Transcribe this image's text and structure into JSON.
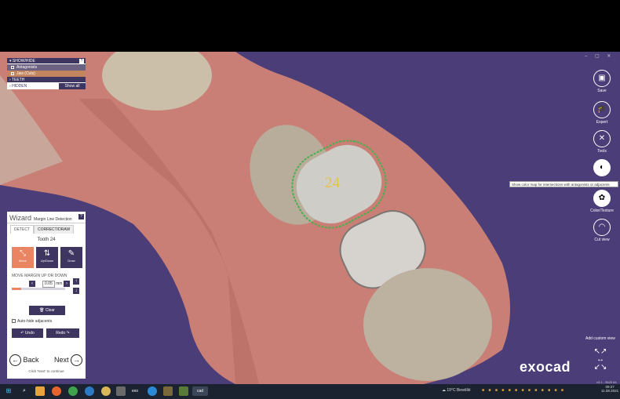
{
  "show_hide": {
    "section_label": "SHOW/HIDE",
    "help": "?",
    "items": [
      {
        "label": "Antagonists",
        "checked": false
      },
      {
        "label": "Jaw (Cuts)",
        "checked": false
      }
    ],
    "teeth_label": "TEETH",
    "hidden_label": "HIDDEN",
    "show_all_label": "Show all"
  },
  "wizard": {
    "title": "Wizard",
    "subtitle": "Margin Line Detection",
    "help": "?",
    "tabs": [
      {
        "label": "DETECT",
        "active": false
      },
      {
        "label": "CORRECT/DRAW",
        "active": true
      }
    ],
    "tooth_label": "Tooth 24",
    "modes": [
      {
        "label": "Move",
        "icon": "move-icon",
        "active": true
      },
      {
        "label": "Up/Down",
        "icon": "updown-icon",
        "active": false
      },
      {
        "label": "Draw",
        "icon": "pencil-icon",
        "active": false
      }
    ],
    "move_label": "MOVE MARGIN UP OR DOWN",
    "step_value": "0.05",
    "step_unit": "mm",
    "slider_fraction": 0.18,
    "clear_label": "Clear",
    "autohide_label": "Auto-hide adjacents",
    "autohide_checked": false,
    "undo_label": "Undo",
    "redo_label": "Redo",
    "back_label": "Back",
    "next_label": "Next",
    "hint": "Click 'Next' to continue"
  },
  "viewport": {
    "tooth_number": "24",
    "background_color": "#4a3d78",
    "margin_line_color": "#4caf50"
  },
  "toolbar": {
    "items": [
      {
        "label": "Save",
        "icon": "save-icon"
      },
      {
        "label": "Expert",
        "icon": "expert-icon"
      },
      {
        "label": "Tools",
        "icon": "tools-icon"
      },
      {
        "label": "",
        "icon": "color-map-icon"
      },
      {
        "label": "Color/Texture",
        "icon": "palette-icon"
      },
      {
        "label": "Cut view",
        "icon": "cut-view-icon"
      }
    ],
    "tooltip": "Show color map for intersections with antagonists or adjacents",
    "add_view_label": "Add custom view",
    "logo": "exocad",
    "version": "v3.1 - 9625 64"
  },
  "taskbar": {
    "weather": "19°C Bewölkt",
    "time": "09:27",
    "date": "11.08.2021",
    "cad_label": "cad",
    "exo_label": "exo"
  }
}
